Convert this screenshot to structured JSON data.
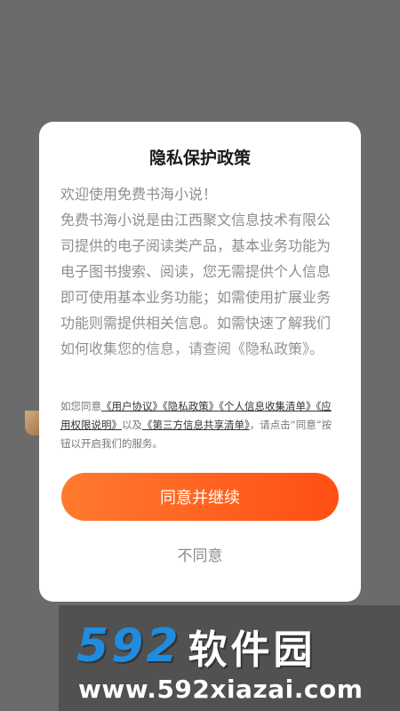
{
  "dialog": {
    "title": "隐私保护政策",
    "body_lines": [
      "欢迎使用免费书海小说！",
      "免费书海小说是由江西聚文信息技术有限公司提供的电子阅读类产品，基本业务功能为电子图书搜索、阅读，您无需提供个人信息即可使用基本业务功能；如需使用扩展业务功能则需提供相关信息。如需快速了解我们如何收集您的信息，请查阅《隐私政策》。"
    ],
    "consent": {
      "prefix": "如您同意",
      "link_user_agreement": "《用户协议》",
      "link_privacy_policy": "《隐私政策》",
      "link_personal_info_list": "《个人信息收集清单》",
      "link_app_permissions": "《应用权限说明》",
      "connector": "以及",
      "link_third_party_list": "《第三方信息共享清单》",
      "suffix": "，请点击“同意”按钮以开启我们的服务。"
    },
    "agree_label": "同意并继续",
    "disagree_label": "不同意"
  },
  "watermark": {
    "brand_number": "592",
    "brand_name": "软件园",
    "url": "www.592xiazai.com"
  },
  "colors": {
    "overlay": "#6b6b6b",
    "accent_start": "#ff7a2e",
    "accent_end": "#ff4f12",
    "watermark_blue": "#1f8cdf"
  }
}
